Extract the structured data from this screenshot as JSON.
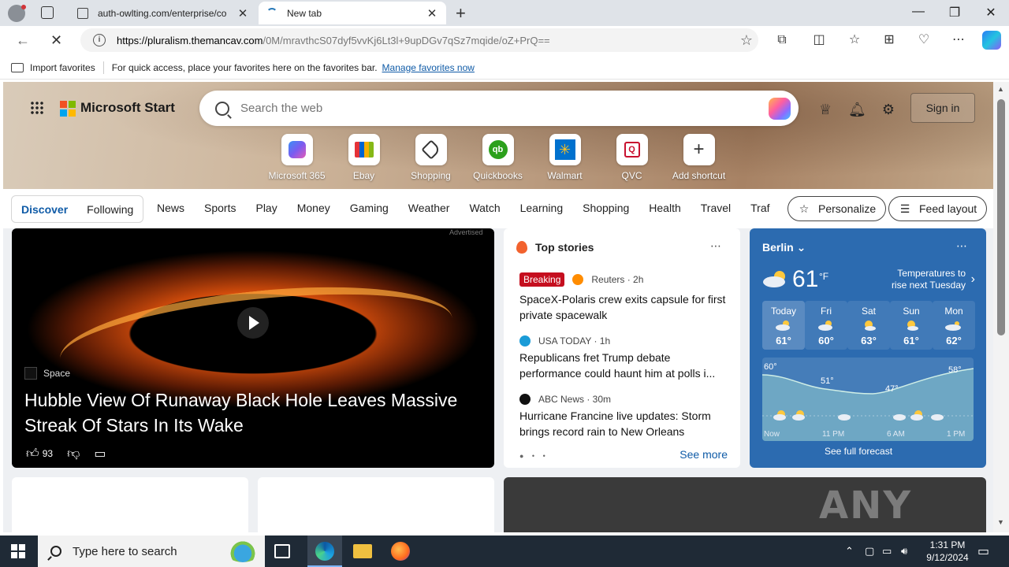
{
  "browser": {
    "tabs": [
      {
        "title": "auth-owlting.com/enterprise/co",
        "active": false
      },
      {
        "title": "New tab",
        "active": true
      }
    ],
    "url_domain": "https://pluralism.themancav.com",
    "url_rest": "/0M/mravthcS07dyf5vvKj6Lt3l+9upDGv7qSz7mqide/oZ+PrQ==",
    "favorites_bar": {
      "import": "Import favorites",
      "hint": "For quick access, place your favorites here on the favorites bar.",
      "manage": "Manage favorites now"
    }
  },
  "start": {
    "brand": "Microsoft Start",
    "search_placeholder": "Search the web",
    "signin": "Sign in",
    "shortcuts": [
      {
        "label": "Microsoft 365",
        "icon": "microsoft365-icon",
        "color": "#7b5cf0"
      },
      {
        "label": "Ebay",
        "icon": "ebay-icon",
        "color": "#e53238"
      },
      {
        "label": "Shopping",
        "icon": "tag-icon",
        "color": "#333333"
      },
      {
        "label": "Quickbooks",
        "icon": "quickbooks-icon",
        "color": "#2ca01c"
      },
      {
        "label": "Walmart",
        "icon": "walmart-icon",
        "color": "#0071ce"
      },
      {
        "label": "QVC",
        "icon": "qvc-icon",
        "color": "#c8102e"
      },
      {
        "label": "Add shortcut",
        "icon": "plus-icon",
        "color": "#333333"
      }
    ]
  },
  "nav": {
    "discover": "Discover",
    "following": "Following",
    "categories": [
      "News",
      "Sports",
      "Play",
      "Money",
      "Gaming",
      "Weather",
      "Watch",
      "Learning",
      "Shopping",
      "Health",
      "Travel",
      "Traf"
    ],
    "personalize": "Personalize",
    "feed_layout": "Feed layout"
  },
  "hero_article": {
    "source": "Space",
    "headline": "Hubble View Of Runaway Black Hole Leaves Massive Streak Of Stars In Its Wake",
    "likes": "93",
    "ad_label": "Advertised"
  },
  "top_stories": {
    "header": "Top stories",
    "items": [
      {
        "badge": "Breaking",
        "publisher": "Reuters · 2h",
        "title": "SpaceX-Polaris crew exits capsule for first private spacewalk"
      },
      {
        "badge": "",
        "publisher": "USA TODAY · 1h",
        "title": "Republicans fret Trump debate performance could haunt him at polls i..."
      },
      {
        "badge": "",
        "publisher": "ABC News · 30m",
        "title": "Hurricane Francine live updates: Storm brings record rain to New Orleans"
      }
    ],
    "see_more": "See more"
  },
  "weather": {
    "city": "Berlin",
    "temp": "61",
    "unit": "°F",
    "note": "Temperatures to rise next Tuesday",
    "days": [
      {
        "name": "Today",
        "temp": "61°"
      },
      {
        "name": "Fri",
        "temp": "60°"
      },
      {
        "name": "Sat",
        "temp": "63°"
      },
      {
        "name": "Sun",
        "temp": "61°"
      },
      {
        "name": "Mon",
        "temp": "62°"
      }
    ],
    "graph_labels": [
      "60°",
      "51°",
      "47°",
      "58°"
    ],
    "time_labels": [
      "Now",
      "11 PM",
      "6 AM",
      "1 PM"
    ],
    "full_forecast": "See full forecast"
  },
  "watermark": "ANY RUN",
  "taskbar": {
    "search_placeholder": "Type here to search",
    "time": "1:31 PM",
    "date": "9/12/2024"
  }
}
